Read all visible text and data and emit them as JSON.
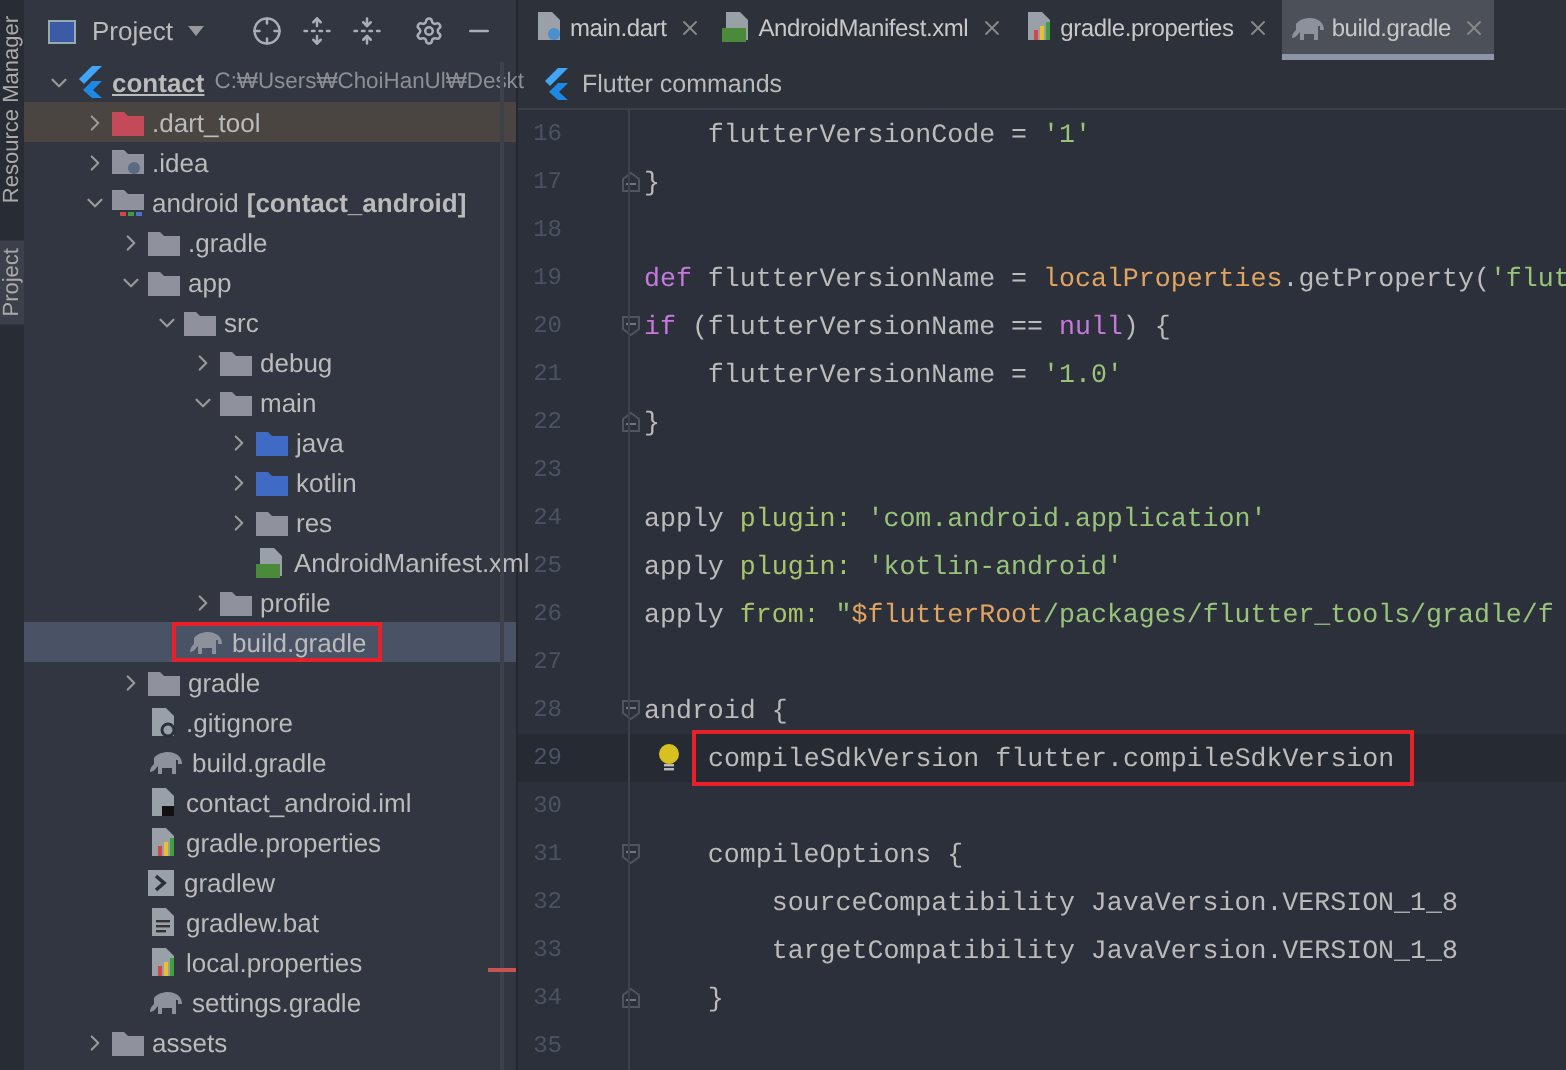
{
  "side_strip": {
    "labels": [
      "Resource Manager",
      "Project"
    ]
  },
  "project_panel": {
    "title": "Project",
    "tree": [
      {
        "label": "contact",
        "path": "C:₩Users₩ChoiHanUl₩Deskt",
        "kind": "flutter",
        "expanded": true,
        "selected": false,
        "highlighted": false,
        "annotated": false,
        "children": [
          {
            "label": ".dart_tool",
            "kind": "folder-excluded",
            "expanded": false,
            "selected": false,
            "highlighted": true,
            "annotated": false
          },
          {
            "label": ".idea",
            "kind": "folder-idea",
            "expanded": false,
            "selected": false,
            "highlighted": false,
            "annotated": false
          },
          {
            "label": "android",
            "module": "[contact_android]",
            "kind": "folder-module",
            "expanded": true,
            "selected": false,
            "highlighted": false,
            "annotated": false,
            "children": [
              {
                "label": ".gradle",
                "kind": "folder",
                "expanded": false,
                "selected": false,
                "highlighted": false,
                "annotated": false
              },
              {
                "label": "app",
                "kind": "folder",
                "expanded": true,
                "selected": false,
                "highlighted": false,
                "annotated": false,
                "children": [
                  {
                    "label": "src",
                    "kind": "folder",
                    "expanded": true,
                    "selected": false,
                    "highlighted": false,
                    "annotated": false,
                    "children": [
                      {
                        "label": "debug",
                        "kind": "folder",
                        "expanded": false,
                        "selected": false,
                        "highlighted": false,
                        "annotated": false
                      },
                      {
                        "label": "main",
                        "kind": "folder",
                        "expanded": true,
                        "selected": false,
                        "highlighted": false,
                        "annotated": false,
                        "children": [
                          {
                            "label": "java",
                            "kind": "folder-source",
                            "expanded": false,
                            "selected": false,
                            "highlighted": false,
                            "annotated": false
                          },
                          {
                            "label": "kotlin",
                            "kind": "folder-source",
                            "expanded": false,
                            "selected": false,
                            "highlighted": false,
                            "annotated": false
                          },
                          {
                            "label": "res",
                            "kind": "folder",
                            "expanded": false,
                            "selected": false,
                            "highlighted": false,
                            "annotated": false
                          },
                          {
                            "label": "AndroidManifest.xml",
                            "kind": "manifest",
                            "selected": false,
                            "highlighted": false,
                            "annotated": false
                          }
                        ]
                      },
                      {
                        "label": "profile",
                        "kind": "folder",
                        "expanded": false,
                        "selected": false,
                        "highlighted": false,
                        "annotated": false
                      }
                    ]
                  },
                  {
                    "label": "build.gradle",
                    "kind": "gradle",
                    "selected": true,
                    "highlighted": false,
                    "annotated": true
                  }
                ]
              },
              {
                "label": "gradle",
                "kind": "folder",
                "expanded": false,
                "selected": false,
                "highlighted": false,
                "annotated": false
              },
              {
                "label": ".gitignore",
                "kind": "gitignore",
                "selected": false,
                "highlighted": false,
                "annotated": false
              },
              {
                "label": "build.gradle",
                "kind": "gradle",
                "selected": false,
                "highlighted": false,
                "annotated": false
              },
              {
                "label": "contact_android.iml",
                "kind": "iml",
                "selected": false,
                "highlighted": false,
                "annotated": false
              },
              {
                "label": "gradle.properties",
                "kind": "properties",
                "selected": false,
                "highlighted": false,
                "annotated": false
              },
              {
                "label": "gradlew",
                "kind": "shell",
                "selected": false,
                "highlighted": false,
                "annotated": false
              },
              {
                "label": "gradlew.bat",
                "kind": "text",
                "selected": false,
                "highlighted": false,
                "annotated": false
              },
              {
                "label": "local.properties",
                "kind": "properties",
                "selected": false,
                "highlighted": false,
                "annotated": false
              },
              {
                "label": "settings.gradle",
                "kind": "gradle",
                "selected": false,
                "highlighted": false,
                "annotated": false
              }
            ]
          },
          {
            "label": "assets",
            "kind": "folder",
            "expanded": false,
            "selected": false,
            "highlighted": false,
            "annotated": false
          }
        ]
      }
    ]
  },
  "editor": {
    "tabs": [
      {
        "label": "main.dart",
        "kind": "dart",
        "selected": false
      },
      {
        "label": "AndroidManifest.xml",
        "kind": "manifest",
        "selected": false
      },
      {
        "label": "gradle.properties",
        "kind": "properties",
        "selected": false
      },
      {
        "label": "build.gradle",
        "kind": "gradle",
        "selected": true
      }
    ],
    "banner": "Flutter commands",
    "lines": [
      {
        "number": "16",
        "fold_start": false,
        "fold_end": false,
        "current": false,
        "annotated": false,
        "tokens": [
          {
            "text": "    flutterVersionCode = ",
            "kind": "plain"
          },
          {
            "text": "'1'",
            "kind": "string"
          }
        ]
      },
      {
        "number": "17",
        "fold_start": false,
        "fold_end": true,
        "current": false,
        "annotated": false,
        "tokens": [
          {
            "text": "}",
            "kind": "plain"
          }
        ]
      },
      {
        "number": "18",
        "fold_start": false,
        "fold_end": false,
        "current": false
      },
      {
        "number": "19",
        "fold_start": false,
        "fold_end": false,
        "current": false,
        "annotated": false,
        "tokens": [
          {
            "text": "def",
            "kind": "keyword"
          },
          {
            "text": " flutterVersionName = ",
            "kind": "plain"
          },
          {
            "text": "localProperties",
            "kind": "field"
          },
          {
            "text": ".getProperty(",
            "kind": "plain"
          },
          {
            "text": "'flut",
            "kind": "string"
          }
        ]
      },
      {
        "number": "20",
        "fold_start": true,
        "fold_end": false,
        "current": false,
        "annotated": false,
        "tokens": [
          {
            "text": "if",
            "kind": "keyword"
          },
          {
            "text": " (flutterVersionName == ",
            "kind": "plain"
          },
          {
            "text": "null",
            "kind": "keyword"
          },
          {
            "text": ") {",
            "kind": "plain"
          }
        ]
      },
      {
        "number": "21",
        "fold_start": false,
        "fold_end": false,
        "current": false,
        "annotated": false,
        "tokens": [
          {
            "text": "    flutterVersionName = ",
            "kind": "plain"
          },
          {
            "text": "'1.0'",
            "kind": "string"
          }
        ]
      },
      {
        "number": "22",
        "fold_start": false,
        "fold_end": true,
        "current": false,
        "annotated": false,
        "tokens": [
          {
            "text": "}",
            "kind": "plain"
          }
        ]
      },
      {
        "number": "23",
        "fold_start": false,
        "fold_end": false,
        "current": false
      },
      {
        "number": "24",
        "fold_start": false,
        "fold_end": false,
        "current": false,
        "annotated": false,
        "tokens": [
          {
            "text": "apply ",
            "kind": "plain"
          },
          {
            "text": "plugin:",
            "kind": "named"
          },
          {
            "text": " 'com.android.application'",
            "kind": "string"
          }
        ]
      },
      {
        "number": "25",
        "fold_start": false,
        "fold_end": false,
        "current": false,
        "annotated": false,
        "tokens": [
          {
            "text": "apply ",
            "kind": "plain"
          },
          {
            "text": "plugin:",
            "kind": "named"
          },
          {
            "text": " 'kotlin-android'",
            "kind": "string"
          }
        ]
      },
      {
        "number": "26",
        "fold_start": false,
        "fold_end": false,
        "current": false,
        "annotated": false,
        "tokens": [
          {
            "text": "apply ",
            "kind": "plain"
          },
          {
            "text": "from:",
            "kind": "named"
          },
          {
            "text": " \"",
            "kind": "string"
          },
          {
            "text": "$flutterRoot",
            "kind": "field"
          },
          {
            "text": "/packages/flutter_tools/gradle/f",
            "kind": "string"
          }
        ]
      },
      {
        "number": "27",
        "fold_start": false,
        "fold_end": false,
        "current": false
      },
      {
        "number": "28",
        "fold_start": true,
        "fold_end": false,
        "current": false,
        "annotated": false,
        "tokens": [
          {
            "text": "android {",
            "kind": "plain"
          }
        ]
      },
      {
        "number": "29",
        "fold_start": false,
        "fold_end": false,
        "current": true,
        "annotated": true,
        "tokens": [
          {
            "text": "compileSdkVersion flutter.compileSdkVersion",
            "kind": "plain"
          }
        ]
      },
      {
        "number": "30",
        "fold_start": false,
        "fold_end": false,
        "current": false
      },
      {
        "number": "31",
        "fold_start": true,
        "fold_end": false,
        "current": false,
        "annotated": false,
        "tokens": [
          {
            "text": "    compileOptions {",
            "kind": "plain"
          }
        ]
      },
      {
        "number": "32",
        "fold_start": false,
        "fold_end": false,
        "current": false,
        "annotated": false,
        "tokens": [
          {
            "text": "        sourceCompatibility JavaVersion.VERSION_1_8",
            "kind": "plain"
          }
        ]
      },
      {
        "number": "33",
        "fold_start": false,
        "fold_end": false,
        "current": false,
        "annotated": false,
        "tokens": [
          {
            "text": "        targetCompatibility JavaVersion.VERSION_1_8",
            "kind": "plain"
          }
        ]
      },
      {
        "number": "34",
        "fold_start": false,
        "fold_end": true,
        "current": false,
        "annotated": false,
        "tokens": [
          {
            "text": "    }",
            "kind": "plain"
          }
        ]
      },
      {
        "number": "35",
        "fold_start": false,
        "fold_end": false,
        "current": false
      }
    ]
  }
}
